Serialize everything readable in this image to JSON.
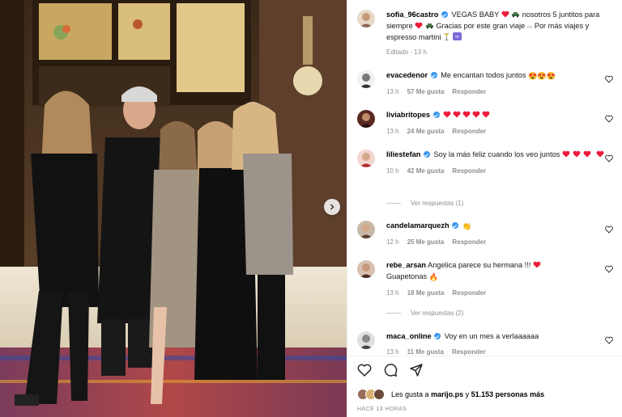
{
  "post": {
    "author": "sofia_96castro",
    "caption_line1": "VEGAS BABY",
    "caption_mid": "nosotros 5 juntitos para",
    "caption_line2": "siempre",
    "caption_mid2": "Gracias por este gran viaje",
    "caption_end": "Por más viajes y",
    "caption_line3": "espresso martini",
    "edited": "Editado · 13 h"
  },
  "comments": [
    {
      "user": "evacedenor",
      "text": "Me encantan todos juntos",
      "time": "13 h",
      "likes": "57 Me gusta",
      "reply": "Responder"
    },
    {
      "user": "liviabritopes",
      "text": "",
      "time": "13 h",
      "likes": "24 Me gusta",
      "reply": "Responder"
    },
    {
      "user": "liliestefan",
      "text": "Soy la más feliz cuando los veo juntos",
      "time": "10 h",
      "likes": "42 Me gusta",
      "reply": "Responder",
      "replies": "Ver respuestas (1)"
    },
    {
      "user": "candelamarquezh",
      "text": "",
      "time": "12 h",
      "likes": "25 Me gusta",
      "reply": "Responder"
    },
    {
      "user": "rebe_arsan",
      "text": "Angelica parece su hermana !!!",
      "text2": "Guapetonas",
      "time": "13 h",
      "likes": "18 Me gusta",
      "reply": "Responder",
      "replies": "Ver respuestas (2)"
    },
    {
      "user": "maca_online",
      "text": "Voy en un mes a verlaaaaaa",
      "time": "13 h",
      "likes": "11 Me gusta",
      "reply": "Responder"
    }
  ],
  "likes_text": {
    "prefix": "Les gusta a",
    "user": "marijo.ps",
    "mid": "y",
    "count": "51.153 personas más"
  },
  "timestamp": "HACE 13 HORAS",
  "colors": {
    "verified": "#3897f0",
    "heart_red": "#ed1c3a",
    "muted": "#8e8e8e"
  },
  "icons": [
    "heart-icon",
    "comment-icon",
    "share-icon",
    "chevron-right-icon",
    "verified-badge-icon"
  ]
}
